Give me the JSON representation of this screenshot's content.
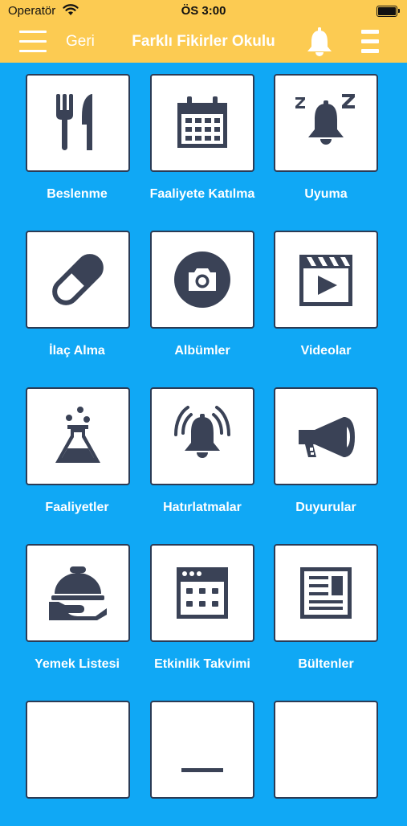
{
  "status_bar": {
    "carrier": "Operatör",
    "time": "ÖS 3:00"
  },
  "nav": {
    "back_label": "Geri",
    "title": "Farklı Fikirler Okulu"
  },
  "tiles": [
    {
      "label": "Beslenme",
      "icon": "utensils-icon"
    },
    {
      "label": "Faaliyete Katılma",
      "icon": "calendar-icon"
    },
    {
      "label": "Uyuma",
      "icon": "sleep-bell-icon"
    },
    {
      "label": "İlaç Alma",
      "icon": "pill-icon"
    },
    {
      "label": "Albümler",
      "icon": "camera-icon"
    },
    {
      "label": "Videolar",
      "icon": "video-icon"
    },
    {
      "label": "Faaliyetler",
      "icon": "flask-icon"
    },
    {
      "label": "Hatırlatmalar",
      "icon": "ringing-bell-icon"
    },
    {
      "label": "Duyurular",
      "icon": "megaphone-icon"
    },
    {
      "label": "Yemek Listesi",
      "icon": "food-tray-icon"
    },
    {
      "label": "Etkinlik Takvimi",
      "icon": "event-calendar-icon"
    },
    {
      "label": "Bültenler",
      "icon": "newsletter-icon"
    }
  ],
  "colors": {
    "header": "#fccb52",
    "background": "#10a8f5",
    "icon": "#3a4256"
  }
}
